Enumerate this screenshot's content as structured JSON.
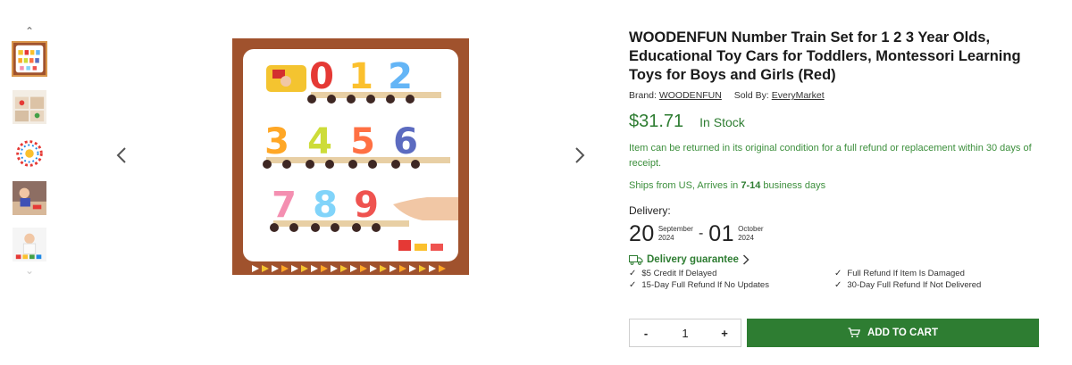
{
  "product": {
    "title": "WOODENFUN Number Train Set for 1 2 3 Year Olds, Educational Toy Cars for Toddlers, Montessori Learning Toys for Boys and Girls (Red)",
    "brand_label": "Brand:",
    "brand": "WOODENFUN",
    "sold_by_label": "Sold By:",
    "sold_by": "EveryMarket",
    "price": "$31.71",
    "stock_status": "In Stock",
    "return_policy": "Item can be returned in its original condition for a full refund or replacement within 30 days of receipt.",
    "ships_prefix": "Ships from US, Arrives in ",
    "ships_days": "7-14",
    "ships_suffix": " business days"
  },
  "delivery": {
    "label": "Delivery:",
    "start_day": "20",
    "start_month": "September",
    "start_year": "2024",
    "separator": "-",
    "end_day": "01",
    "end_month": "October",
    "end_year": "2024"
  },
  "guarantee": {
    "title": "Delivery guarantee",
    "items": [
      "$5 Credit If Delayed",
      "Full Refund If Item Is Damaged",
      "15-Day Full Refund If No Updates",
      "30-Day Full Refund If Not Delivered"
    ]
  },
  "cart": {
    "minus": "-",
    "quantity": "1",
    "plus": "+",
    "add_label": "ADD TO CART"
  },
  "image": {
    "digits_row1": [
      "0",
      "1",
      "2"
    ],
    "digits_row2": [
      "3",
      "4",
      "5",
      "6"
    ],
    "digits_row3": [
      "7",
      "8",
      "9"
    ]
  },
  "icons": {
    "thumb_up": "chevron-up-icon",
    "thumb_down": "chevron-down-icon",
    "prev": "chevron-left-icon",
    "next": "chevron-right-icon",
    "truck": "truck-icon",
    "cart": "cart-icon"
  },
  "colors": {
    "accent": "#2e7d32",
    "frame": "#a0522d",
    "active_thumb": "#d9954a"
  }
}
